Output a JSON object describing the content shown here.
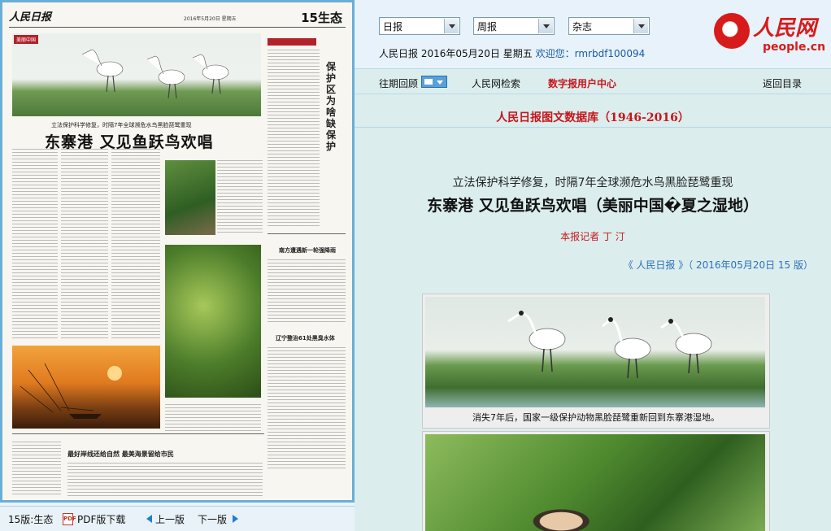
{
  "paper": {
    "logo": "人民日报",
    "date_line": "2016年5月20日 星期五",
    "edition": "15生态",
    "tag": "美丽中国",
    "sub": "立法保护科学修复，时隔7年全球濒危水鸟黑脸琵鹭重现",
    "headline": "东寨港 又见鱼跃鸟欢唱",
    "vertical_title": "保护区为啥缺保护",
    "mid_head_1": "南方遭遇新一轮强降雨",
    "mid_head_2": "辽宁整治61处黑臭水体",
    "bottom_head": "最好岸线还给自然 最美海景留给市民"
  },
  "pager": {
    "edition_label": "15版:生态",
    "pdf_label": "PDF版下载",
    "prev_label": "上一版",
    "next_label": "下一版"
  },
  "header": {
    "select_daily": "日报",
    "select_weekly": "周报",
    "select_magazine": "杂志",
    "paper_name": "人民日报",
    "date": "2016年05月20日",
    "weekday": "星期五",
    "welcome": "欢迎您：rmrbdf100094",
    "brand_name": "人民网",
    "brand_url": "people.cn"
  },
  "nav": {
    "archive": "往期回顾",
    "search": "人民网检索",
    "digital": "数字报用户中心",
    "back": "返回目录"
  },
  "article": {
    "db_title": "人民日报图文数据库（1946-2016）",
    "subtitle": "立法保护科学修复，时隔7年全球濒危水鸟黑脸琵鹭重现",
    "title": "东寨港 又见鱼跃鸟欢唱（美丽中国�夏之湿地）",
    "author": "本报记者 丁 汀",
    "source": "《 人民日报 》（ 2016年05月20日 15 版）",
    "caption": "消失7年后，国家一级保护动物黑脸琵鹭重新回到东寨港湿地。"
  },
  "colors": {
    "accent_red": "#c8161d",
    "link_blue": "#2c6fbc",
    "panel_bg": "#dbeeed"
  }
}
